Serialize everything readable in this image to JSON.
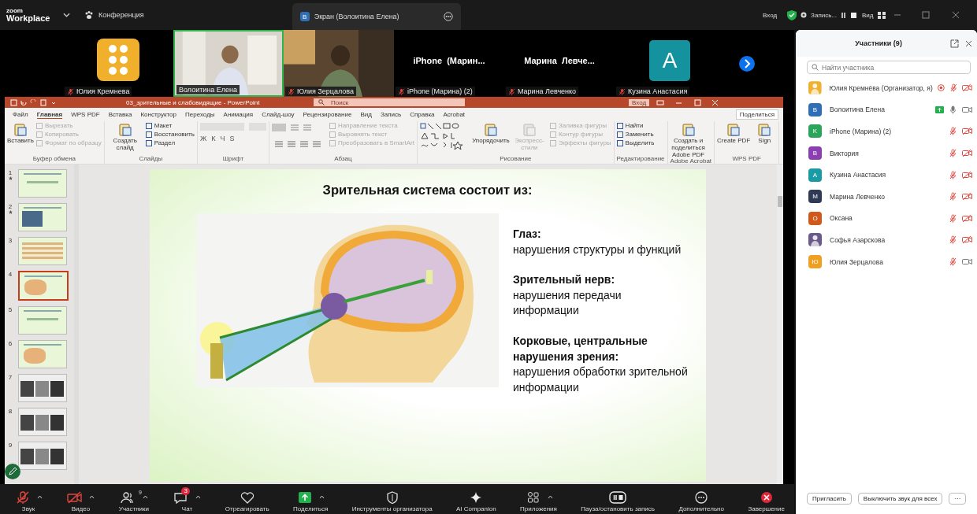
{
  "topbar": {
    "logo_top": "zoom",
    "logo_bottom": "Workplace",
    "tabs": [
      {
        "label": "Конференция",
        "kind": "meeting",
        "selected": false
      },
      {
        "label": "Экран (Волоитина Елена)",
        "kind": "screen",
        "badge": "В",
        "selected": true
      }
    ],
    "signin": "Вход",
    "recording": "Запись...",
    "view": "Вид"
  },
  "tiles": [
    {
      "kind": "logo",
      "name": "Юлия Кремнева",
      "muted": true,
      "active": false
    },
    {
      "kind": "video",
      "name": "Волоитина Елена",
      "muted": false,
      "active": true
    },
    {
      "kind": "video",
      "name": "Юлия Зерцалова",
      "muted": true,
      "active": false
    },
    {
      "kind": "name",
      "title": "iPhone  (Марин...",
      "name": "iPhone (Марина) (2)",
      "muted": true,
      "active": false
    },
    {
      "kind": "name",
      "title": "Марина  Левче...",
      "name": "Марина Левченко",
      "muted": true,
      "active": false
    },
    {
      "kind": "letter",
      "initial": "A",
      "color": "#14939e",
      "name": "Кузина Анастасия",
      "muted": true,
      "active": false
    }
  ],
  "powerpoint": {
    "title": "03_зрительные и слабовидящие  -  PowerPoint",
    "search": "Поиск",
    "signin": "Вход",
    "share": "Поделиться",
    "tabs": [
      {
        "label": "Файл",
        "selected": false
      },
      {
        "label": "Главная",
        "selected": true
      },
      {
        "label": "WPS PDF",
        "selected": false
      },
      {
        "label": "Вставка",
        "selected": false
      },
      {
        "label": "Конструктор",
        "selected": false
      },
      {
        "label": "Переходы",
        "selected": false
      },
      {
        "label": "Анимация",
        "selected": false
      },
      {
        "label": "Слайд-шоу",
        "selected": false
      },
      {
        "label": "Рецензирование",
        "selected": false
      },
      {
        "label": "Вид",
        "selected": false
      },
      {
        "label": "Запись",
        "selected": false
      },
      {
        "label": "Справка",
        "selected": false
      },
      {
        "label": "Acrobat",
        "selected": false
      }
    ],
    "groups": [
      {
        "label": "Буфер обмена",
        "kind": "tools",
        "items": [
          {
            "label": "Вставить",
            "kind": "big",
            "disabled": false
          },
          {
            "label": "Вырезать",
            "kind": "small",
            "disabled": true
          },
          {
            "label": "Копировать",
            "kind": "small",
            "disabled": true
          },
          {
            "label": "Формат по образцу",
            "kind": "small",
            "disabled": true
          }
        ]
      },
      {
        "label": "Слайды",
        "kind": "tools",
        "items": [
          {
            "label": "Создать слайд",
            "kind": "big",
            "disabled": false
          },
          {
            "label": "Макет",
            "kind": "small",
            "disabled": false
          },
          {
            "label": "Восстановить",
            "kind": "small",
            "disabled": false
          },
          {
            "label": "Раздел",
            "kind": "small",
            "disabled": false
          }
        ]
      },
      {
        "label": "Шрифт",
        "kind": "font",
        "glyphs": [
          "Ж",
          "К",
          "Ч",
          "S"
        ]
      },
      {
        "label": "Абзац",
        "kind": "paragraph",
        "items": [
          {
            "label": "Направление текста",
            "kind": "small",
            "disabled": true
          },
          {
            "label": "Выровнять текст",
            "kind": "small",
            "disabled": true
          },
          {
            "label": "Преобразовать в SmartArt",
            "kind": "small",
            "disabled": true
          }
        ]
      },
      {
        "label": "Рисование",
        "kind": "drawing",
        "items": [
          {
            "label": "Упорядочить",
            "kind": "big",
            "disabled": false
          },
          {
            "label": "Экспресс-стили",
            "kind": "big",
            "disabled": true
          },
          {
            "label": "Заливка фигуры",
            "kind": "small",
            "disabled": true
          },
          {
            "label": "Контур фигуры",
            "kind": "small",
            "disabled": true
          },
          {
            "label": "Эффекты фигуры",
            "kind": "small",
            "disabled": true
          }
        ]
      },
      {
        "label": "Редактирование",
        "kind": "tools",
        "items": [
          {
            "label": "Найти",
            "kind": "small",
            "disabled": false
          },
          {
            "label": "Заменить",
            "kind": "small",
            "disabled": false
          },
          {
            "label": "Выделить",
            "kind": "small",
            "disabled": false
          }
        ]
      },
      {
        "label": "Adobe Acrobat",
        "kind": "tools",
        "items": [
          {
            "label": "Создать и поделиться Adobe PDF",
            "kind": "big",
            "disabled": false
          }
        ]
      },
      {
        "label": "WPS PDF",
        "kind": "tools",
        "items": [
          {
            "label": "Create PDF",
            "kind": "big",
            "disabled": false
          },
          {
            "label": "Sign",
            "kind": "big",
            "disabled": false
          }
        ]
      }
    ],
    "slides": [
      {
        "number": "1",
        "starred": true,
        "selected": false
      },
      {
        "number": "2",
        "starred": true,
        "selected": false
      },
      {
        "number": "3",
        "starred": false,
        "selected": false
      },
      {
        "number": "4",
        "starred": false,
        "selected": true
      },
      {
        "number": "5",
        "starred": false,
        "selected": false
      },
      {
        "number": "6",
        "starred": false,
        "selected": false
      },
      {
        "number": "7",
        "starred": false,
        "selected": false
      },
      {
        "number": "8",
        "starred": false,
        "selected": false
      },
      {
        "number": "9",
        "starred": false,
        "selected": false
      }
    ],
    "slide": {
      "title": "Зрительная система состоит из:",
      "blocks": [
        {
          "heading": "Глаз:",
          "text": "нарушения структуры и функций"
        },
        {
          "heading": "Зрительный нерв:",
          "text": "нарушения передачи информации"
        },
        {
          "heading": "Корковые, центральные нарушения зрения:",
          "text": "нарушения обработки зрительной информации"
        }
      ]
    }
  },
  "participants": {
    "title": "Участники (9)",
    "search_placeholder": "Найти участника",
    "people": [
      {
        "name": "Юлия Кремнёва (Организатор, я)",
        "kind": "picture",
        "color": "#f0b030",
        "recording": true,
        "sharing": false,
        "muted": true,
        "video": false
      },
      {
        "name": "Волоитина Елена",
        "kind": "letter",
        "initial": "В",
        "color": "#2f6fb5",
        "recording": false,
        "sharing": true,
        "muted": false,
        "video": true
      },
      {
        "name": "iPhone (Марина) (2)",
        "kind": "letter",
        "initial": "K",
        "color": "#2aa55a",
        "recording": false,
        "sharing": false,
        "muted": true,
        "video": false
      },
      {
        "name": "Виктория",
        "kind": "letter",
        "initial": "В",
        "color": "#8c3fb0",
        "recording": false,
        "sharing": false,
        "muted": true,
        "video": false
      },
      {
        "name": "Кузина Анастасия",
        "kind": "letter",
        "initial": "А",
        "color": "#1a9aa5",
        "recording": false,
        "sharing": false,
        "muted": true,
        "video": false
      },
      {
        "name": "Марина Левченко",
        "kind": "letter",
        "initial": "М",
        "color": "#2f3a55",
        "recording": false,
        "sharing": false,
        "muted": true,
        "video": false
      },
      {
        "name": "Оксана",
        "kind": "letter",
        "initial": "О",
        "color": "#d0581a",
        "recording": false,
        "sharing": false,
        "muted": true,
        "video": false
      },
      {
        "name": "Софья Азарскова",
        "kind": "picture",
        "color": "#6a5a8a",
        "recording": false,
        "sharing": false,
        "muted": true,
        "video": false
      },
      {
        "name": "Юлия Зерцалова",
        "kind": "letter",
        "initial": "Ю",
        "color": "#f0a020",
        "recording": false,
        "sharing": false,
        "muted": true,
        "video": true
      }
    ],
    "buttons": [
      "Пригласить",
      "Выключить звук для всех"
    ],
    "more": "···"
  },
  "toolbar": [
    {
      "kind": "audio",
      "label": "Звук",
      "off": true,
      "caret": true
    },
    {
      "kind": "video",
      "label": "Видео",
      "off": true,
      "caret": true
    },
    {
      "kind": "participants",
      "label": "Участники",
      "count": "9",
      "caret": true
    },
    {
      "kind": "chat",
      "label": "Чат",
      "badge": "3",
      "caret": true
    },
    {
      "kind": "react",
      "label": "Отреагировать",
      "caret": false
    },
    {
      "kind": "share",
      "label": "Поделиться",
      "caret": true
    },
    {
      "kind": "host",
      "label": "Инструменты организатора",
      "caret": false
    },
    {
      "kind": "ai",
      "label": "AI Companion",
      "caret": false
    },
    {
      "kind": "apps",
      "label": "Приложения",
      "caret": true
    },
    {
      "kind": "record",
      "label": "Пауза/остановить запись",
      "caret": false
    },
    {
      "kind": "more",
      "label": "Дополнительно",
      "caret": false
    },
    {
      "kind": "end",
      "label": "Завершение",
      "caret": false
    }
  ]
}
